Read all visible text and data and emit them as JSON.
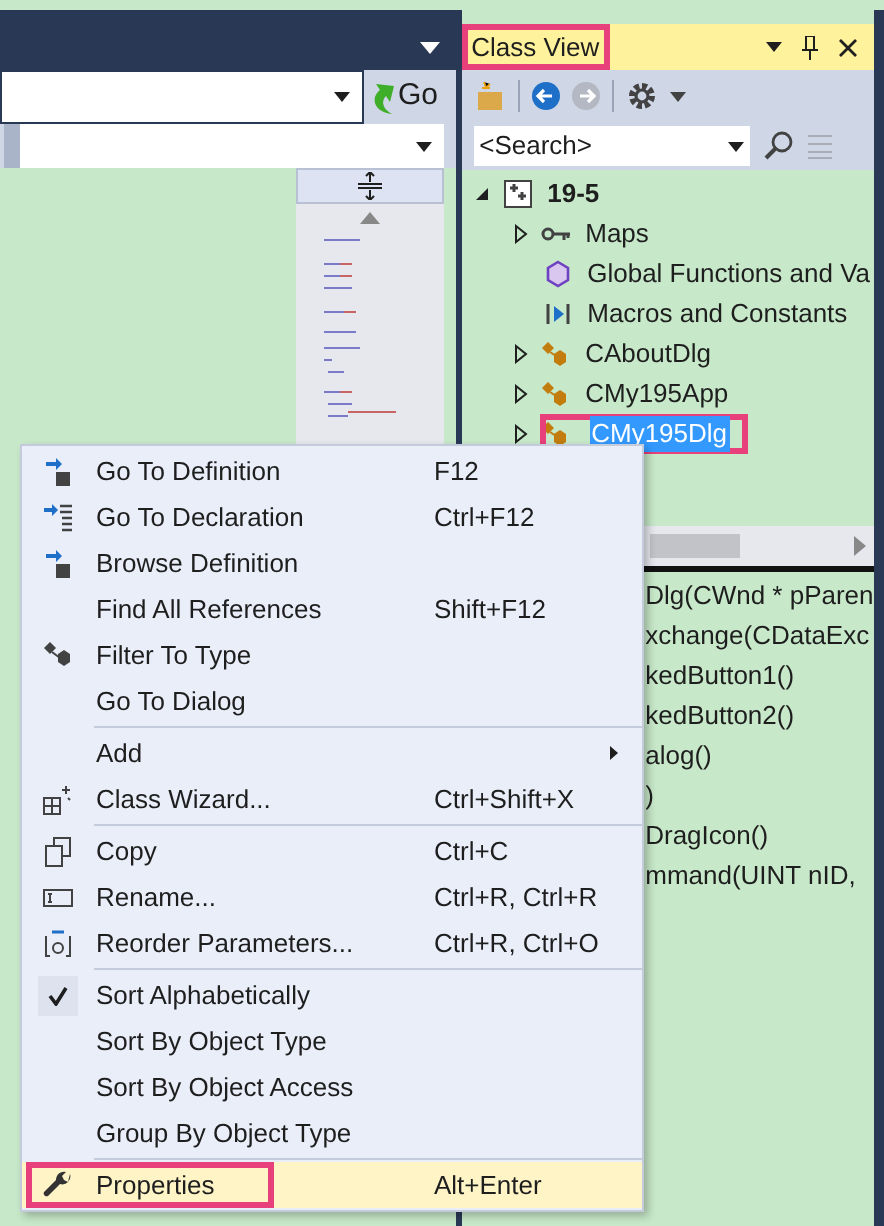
{
  "editor": {
    "go_button": "Go"
  },
  "class_view": {
    "title": "Class View",
    "outlined": true,
    "search": {
      "value": "<Search>"
    },
    "tree": [
      {
        "label": "19-5",
        "expanded": true,
        "selected": false,
        "outlined": false,
        "children": [
          {
            "label": "Maps",
            "expandable": true,
            "selected": false,
            "outlined": false
          },
          {
            "label": "Global Functions and Va",
            "expandable": false,
            "selected": false,
            "outlined": false
          },
          {
            "label": "Macros and Constants",
            "expandable": false,
            "selected": false,
            "outlined": false
          },
          {
            "label": "CAboutDlg",
            "expandable": true,
            "selected": false,
            "outlined": false
          },
          {
            "label": "CMy195App",
            "expandable": true,
            "selected": false,
            "outlined": false
          },
          {
            "label": "CMy195Dlg",
            "expandable": true,
            "selected": true,
            "outlined": true
          }
        ]
      }
    ],
    "members": [
      "Dlg(CWnd * pParen",
      "xchange(CDataExc",
      "kedButton1()",
      "kedButton2()",
      "alog()",
      ")",
      "DragIcon()",
      "mmand(UINT nID,"
    ]
  },
  "context_menu": {
    "groups": [
      [
        {
          "label": "Go To Definition",
          "shortcut": "F12"
        },
        {
          "label": "Go To Declaration",
          "shortcut": "Ctrl+F12"
        },
        {
          "label": "Browse Definition"
        },
        {
          "label": "Find All References",
          "shortcut": "Shift+F12"
        },
        {
          "label": "Filter To Type"
        },
        {
          "label": "Go To Dialog"
        }
      ],
      [
        {
          "label": "Add",
          "submenu": true
        },
        {
          "label": "Class Wizard...",
          "shortcut": "Ctrl+Shift+X"
        }
      ],
      [
        {
          "label": "Copy",
          "shortcut": "Ctrl+C"
        },
        {
          "label": "Rename...",
          "shortcut": "Ctrl+R, Ctrl+R"
        },
        {
          "label": "Reorder Parameters...",
          "shortcut": "Ctrl+R, Ctrl+O"
        }
      ],
      [
        {
          "label": "Sort Alphabetically",
          "checked": true
        },
        {
          "label": "Sort By Object Type",
          "checked": false
        },
        {
          "label": "Sort By Object Access",
          "checked": false
        },
        {
          "label": "Group By Object Type",
          "checked": false
        }
      ],
      [
        {
          "label": "Properties",
          "shortcut": "Alt+Enter",
          "selected": true,
          "outlined": true
        }
      ]
    ]
  }
}
